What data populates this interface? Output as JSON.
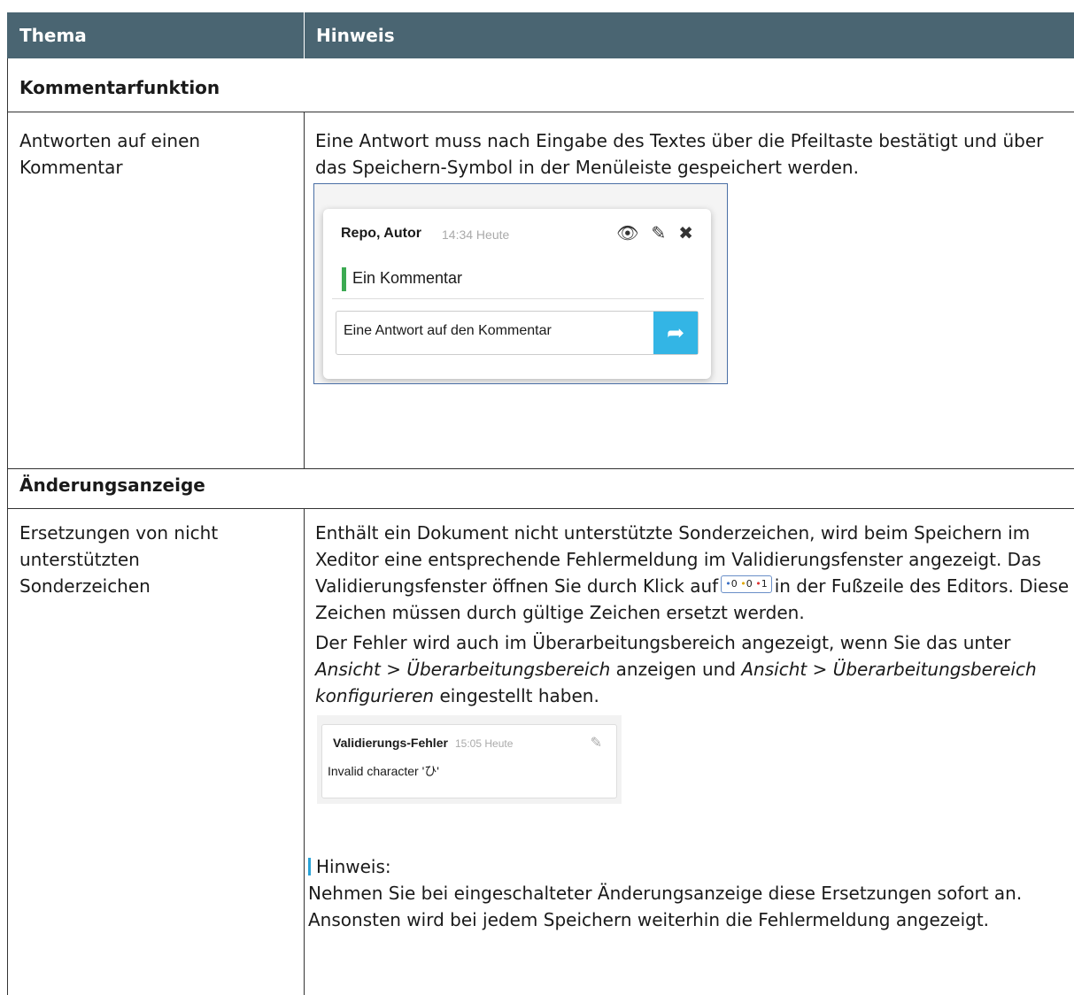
{
  "header": {
    "col1": "Thema",
    "col2": "Hinweis"
  },
  "sections": [
    {
      "title": "Kommentarfunktion",
      "row": {
        "topic": "Antworten auf einen Kommentar",
        "text": "Eine Antwort muss nach Eingabe des Textes über die Pfeiltaste bestätigt und über das Speichern-Symbol in der Menüleiste gespeichert werden.",
        "screenshot": {
          "author": "Repo, Autor",
          "time": "14:34 Heute",
          "comment": "Ein Kommentar",
          "reply_value": "Eine Antwort auf den Kommentar",
          "icons": [
            "eye-icon",
            "pencil-icon",
            "close-icon",
            "reply-arrow-icon"
          ],
          "accent_color": "#33b5e5",
          "bar_color": "#3caa52"
        }
      }
    },
    {
      "title": "Änderungsanzeige",
      "row": {
        "topic": "Ersetzungen von nicht unterstützten Sonderzeichen",
        "text1_before": "Enthält ein Dokument nicht unterstützte Sonderzeichen, wird beim Speichern im Xeditor eine entsprechende Fehlermeldung im Validierungsfenster angezeigt. Das Validierungsfenster öffnen Sie durch Klick auf",
        "badge": {
          "blue": "0",
          "yellow": "0",
          "red": "1"
        },
        "text1_after": "in der Fußzeile des Editors. Diese Zeichen müssen durch gültige Zeichen ersetzt werden.",
        "text2_a": "Der Fehler wird auch im Überarbeitungsbereich angezeigt, wenn Sie das unter",
        "text2_em1": "Ansicht > Überarbeitungsbereich",
        "text2_b": "anzeigen und",
        "text2_em2": "Ansicht > Überarbeitungsbereich konfigurieren",
        "text2_c": "eingestellt haben.",
        "screenshot": {
          "title": "Validierungs-Fehler",
          "time": "15:05 Heute",
          "message": "Invalid character 'ひ'",
          "icons": [
            "edit-icon"
          ]
        },
        "note_label": "Hinweis:",
        "note_text": "Nehmen Sie bei eingeschalteter Änderungsanzeige diese Ersetzungen sofort an. Ansonsten wird bei jedem Speichern weiterhin die Fehlermeldung angezeigt.",
        "note_color": "#29a3d8"
      }
    }
  ],
  "colors": {
    "header_bg": "#4a6572",
    "header_text": "#ffffff"
  }
}
